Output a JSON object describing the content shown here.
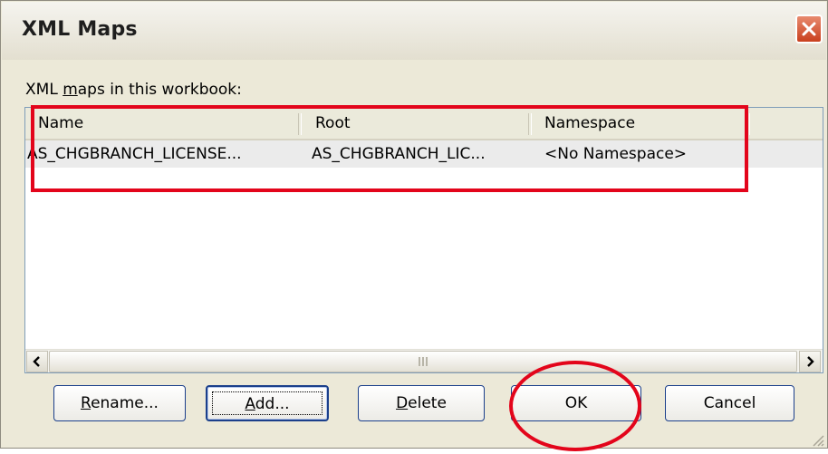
{
  "window": {
    "title": "XML Maps",
    "close_icon": "close-icon"
  },
  "section_label": {
    "prefix": "XML ",
    "mnemonic": "m",
    "suffix": "aps in this workbook:"
  },
  "table": {
    "columns": [
      "Name",
      "Root",
      "Namespace"
    ],
    "rows": [
      [
        "AS_CHGBRANCH_LICENSE...",
        "AS_CHGBRANCH_LIC...",
        "<No Namespace>"
      ]
    ]
  },
  "buttons": {
    "rename": {
      "mnemonic": "R",
      "rest": "ename..."
    },
    "add": {
      "mnemonic": "A",
      "rest": "dd..."
    },
    "delete": {
      "mnemonic": "D",
      "rest": "elete"
    },
    "ok": "OK",
    "cancel": "Cancel"
  },
  "colors": {
    "annotation": "#e3051b",
    "dialog_bg": "#ece9d8",
    "close_button": "#c9401e"
  }
}
